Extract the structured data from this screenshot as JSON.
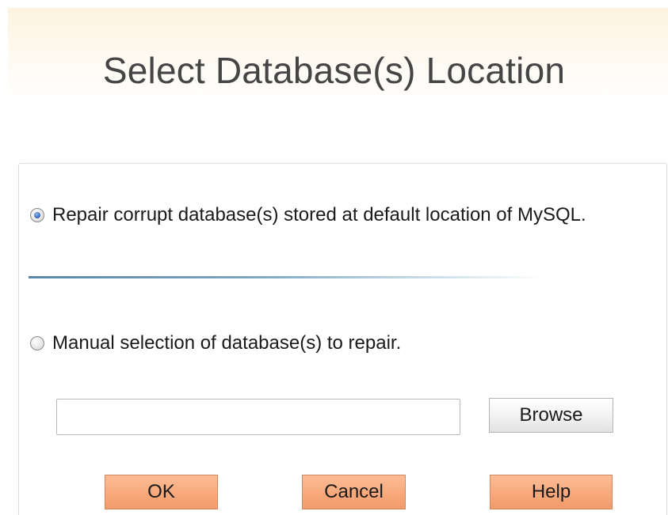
{
  "dialog": {
    "title": "Select Database(s) Location"
  },
  "options": {
    "default_location": {
      "label": "Repair corrupt database(s) stored at default location of MySQL.",
      "selected": true
    },
    "manual_selection": {
      "label": "Manual selection of database(s) to repair.",
      "selected": false
    }
  },
  "path_input": {
    "value": "",
    "placeholder": ""
  },
  "buttons": {
    "browse": "Browse",
    "ok": "OK",
    "cancel": "Cancel",
    "help": "Help"
  },
  "colors": {
    "header_gradient": "#fdf3df",
    "primary_button": "#f7a77a",
    "separator": "#5a86a8",
    "radio_selected": "#2d63b5"
  },
  "icons": {
    "default_radio": "radio-selected-icon",
    "manual_radio": "radio-unselected-icon"
  }
}
